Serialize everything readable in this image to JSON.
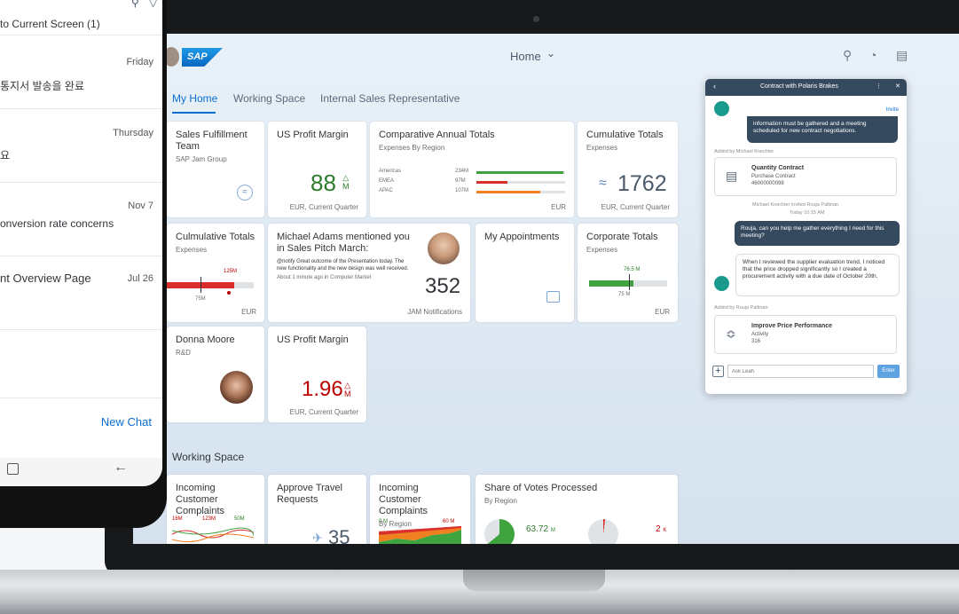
{
  "shell": {
    "title": "Home"
  },
  "tabs": [
    "My Home",
    "Working Space",
    "Internal Sales Representative"
  ],
  "tiles": {
    "t1": {
      "title": "Sales Fulfillment Team",
      "sub": "SAP Jam Group"
    },
    "t2": {
      "title": "US Profit Margin",
      "value": "88",
      "unit": "M",
      "foot": "EUR, Current Quarter"
    },
    "t3": {
      "title": "Comparative Annual Totals",
      "sub": "Expenses By Region",
      "foot": "EUR",
      "rows": [
        {
          "label": "Americas",
          "value": "234M",
          "pct": 0.98,
          "color": "#3fa33f"
        },
        {
          "label": "EMEA",
          "value": "97M",
          "pct": 0.35,
          "color": "#d9302e"
        },
        {
          "label": "APAC",
          "value": "107M",
          "pct": 0.72,
          "color": "#f07f1f"
        }
      ]
    },
    "t4": {
      "title": "Cumulative Totals",
      "sub": "Expenses",
      "value": "1762",
      "foot": "EUR, Current Quarter"
    },
    "t5": {
      "title": "Culmulative Totals",
      "sub": "Expenses",
      "target": "125M",
      "actual": "75M",
      "foot": "EUR"
    },
    "t6": {
      "title": "Michael Adams mentioned you in Sales Pitch March:",
      "body": "@notify Great outcome of the Presentation today. The new functionality and the new design was well received.",
      "time": "About 1 minute ago in Computer Market",
      "value": "352",
      "foot": "JAM Notifications"
    },
    "t7": {
      "title": "My Appointments"
    },
    "t8": {
      "title": "Corporate Totals",
      "sub": "Expenses",
      "target": "76.5 M",
      "actual": "75 M",
      "foot": "EUR"
    },
    "t9": {
      "title": "Donna Moore",
      "sub": "R&D"
    },
    "t10": {
      "title": "US Profit Margin",
      "value": "1.96",
      "unit": "M",
      "foot": "EUR, Current Quarter"
    }
  },
  "working": {
    "title": "Working Space",
    "w1": {
      "title": "Incoming Customer Complaints",
      "labels": [
        "16M",
        "123M",
        "50M"
      ]
    },
    "w2": {
      "title": "Approve Travel Requests",
      "value": "35"
    },
    "w3": {
      "title": "Incoming Customer Complaints",
      "sub": "By Region",
      "labels": [
        "0 M",
        "60 M"
      ]
    },
    "w4": {
      "title": "Share of Votes Processed",
      "sub": "By Region",
      "v1": "63.72",
      "u1": "M",
      "v2": "2",
      "u2": "K"
    }
  },
  "chat": {
    "title": "Contract with Polaris Brakes",
    "invite": "Invite",
    "msg1": "information must be gathered and a meeting scheduled for new contract negotiations.",
    "added1": "Added by Michael Knechter",
    "card1": {
      "title": "Quantity Contract",
      "line1": "Purchase Contract",
      "line2": "46000000098"
    },
    "invite_note": "Michael Knechter invited Rouja Paltinan",
    "today": "Today",
    "time": "10:15 AM",
    "msg2": "Rouja, can you help me gather everything I need for this meeting?",
    "msg3": "When I reviewed the supplier evaluation trend, I noticed that the price dropped significantly so I created a procurement activity with a due date of October 20th.",
    "added2": "Added by Rouja Paltinan",
    "card2": {
      "title": "Improve Price Performance",
      "line1": "Activity",
      "line2": "316"
    },
    "input_placeholder": "Ask Leah",
    "enter": "Enter"
  },
  "phone": {
    "header": "to Current Screen (1)",
    "items": [
      {
        "date": "Friday",
        "text": "통지서 발송을 완료"
      },
      {
        "date": "Thursday",
        "text": "요"
      },
      {
        "date": "Nov 7",
        "text": "onversion rate concerns"
      },
      {
        "date": "Jul 26",
        "text": "nt Overview Page"
      }
    ],
    "new_chat": "New Chat"
  }
}
